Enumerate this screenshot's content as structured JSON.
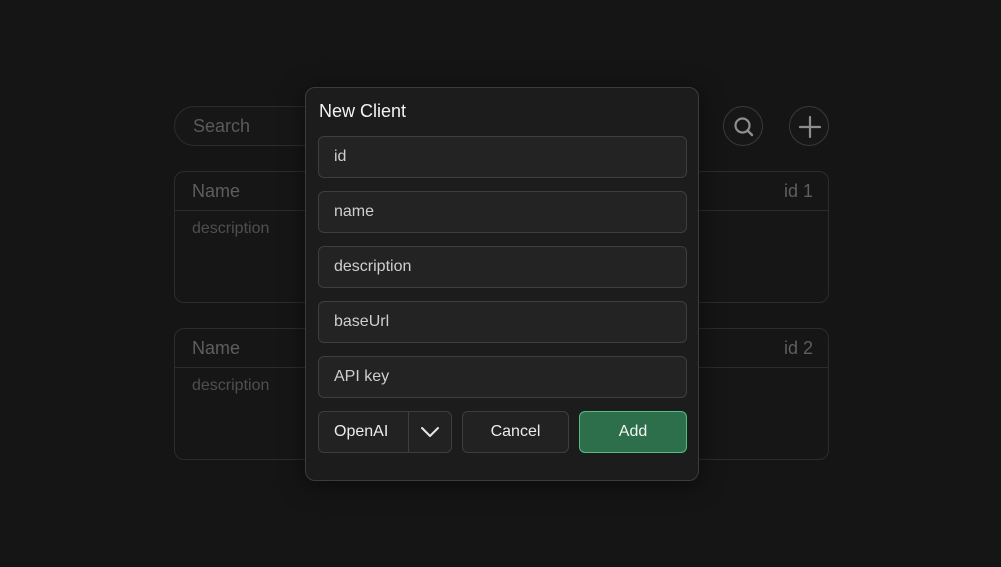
{
  "background": {
    "search": {
      "placeholder": "Search"
    },
    "cards": [
      {
        "name": "Name",
        "id": "id 1",
        "description": "description"
      },
      {
        "name": "Name",
        "id": "id 2",
        "description": "description"
      }
    ],
    "icons": {
      "search": "search-icon",
      "add": "plus-icon"
    }
  },
  "dialog": {
    "title": "New Client",
    "fields": {
      "id": {
        "placeholder": "id"
      },
      "name": {
        "placeholder": "name"
      },
      "description": {
        "placeholder": "description"
      },
      "baseUrl": {
        "placeholder": "baseUrl"
      },
      "apiKey": {
        "placeholder": "API key"
      }
    },
    "provider": {
      "value": "OpenAI",
      "icon": "chevron-down-icon"
    },
    "cancel_label": "Cancel",
    "add_label": "Add"
  },
  "colors": {
    "page_bg": "#151515",
    "dialog_bg": "#1c1c1c",
    "accent": "#2d6e4b",
    "accent_border": "#4fbf82"
  }
}
